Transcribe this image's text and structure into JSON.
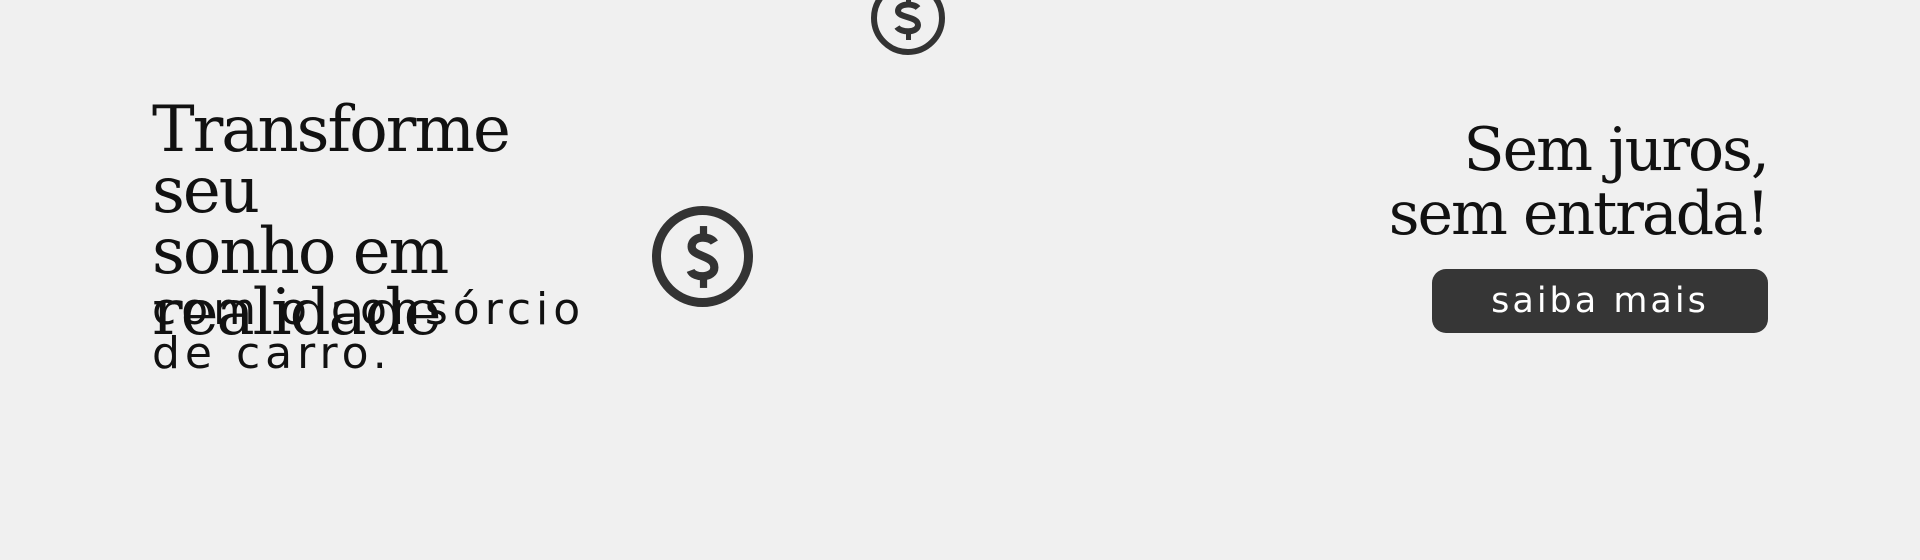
{
  "hero": {
    "title_line1": "Transforme seu",
    "title_line2": "sonho em",
    "title_line3": "realidade",
    "subtitle_line1": "com o consórcio",
    "subtitle_line2": "de carro."
  },
  "promo": {
    "line1": "Sem juros,",
    "line2": "sem entrada!",
    "cta_label": "saiba mais"
  },
  "icons": {
    "main": "dollar-coin-icon",
    "top": "dollar-coin-icon"
  },
  "colors": {
    "background": "#f0f0f0",
    "accent": "#363636",
    "text": "#111111",
    "button_text": "#ffffff"
  }
}
